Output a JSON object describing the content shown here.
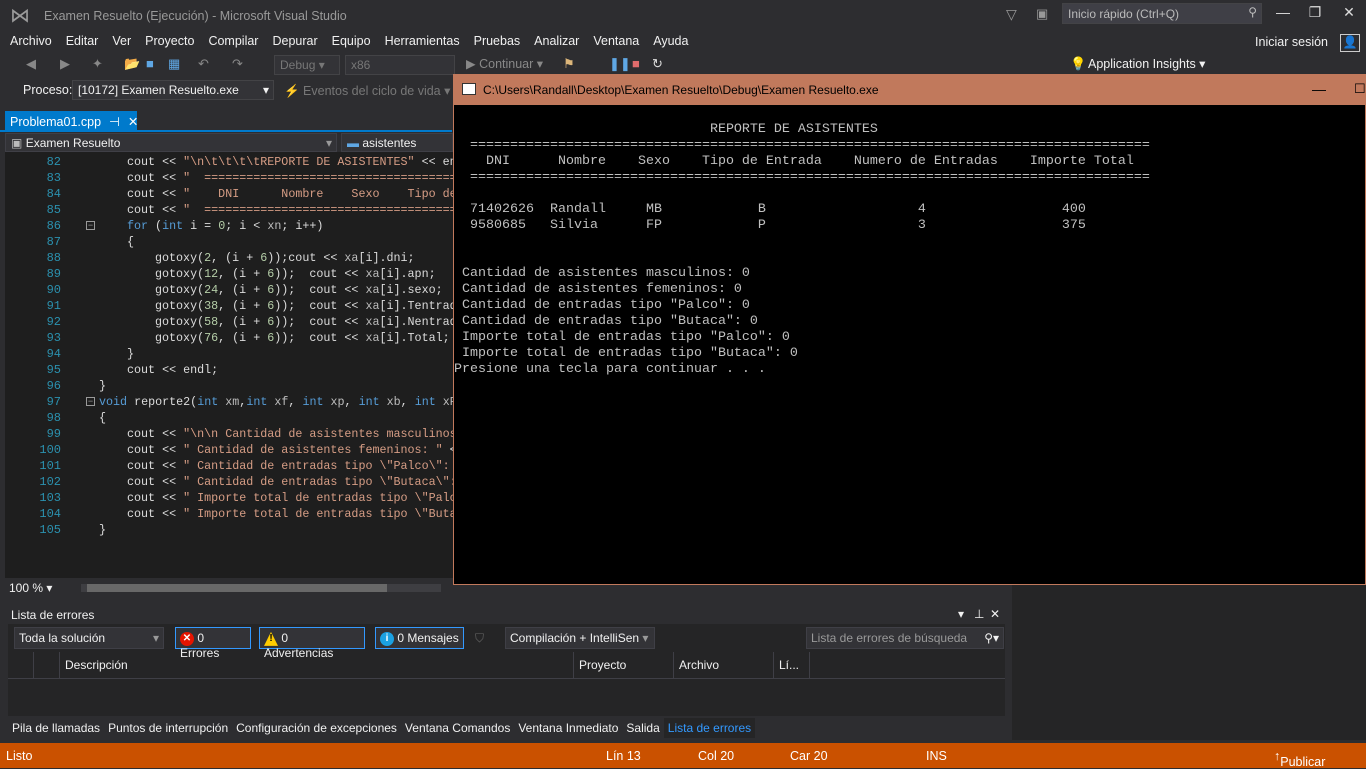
{
  "window": {
    "title": "Examen Resuelto (Ejecución) - Microsoft Visual Studio",
    "quick_launch_placeholder": "Inicio rápido (Ctrl+Q)"
  },
  "menu": [
    "Archivo",
    "Editar",
    "Ver",
    "Proyecto",
    "Compilar",
    "Depurar",
    "Equipo",
    "Herramientas",
    "Pruebas",
    "Analizar",
    "Ventana",
    "Ayuda"
  ],
  "signin": "Iniciar sesión",
  "toolbar": {
    "config": "Debug",
    "platform": "x86",
    "continue": "Continuar",
    "app_insights": "Application Insights"
  },
  "process": {
    "label": "Proceso:",
    "value": "[10172] Examen Resuelto.exe",
    "lifecycle": "Eventos del ciclo de vida"
  },
  "doc_tab": {
    "name": "Problema01.cpp"
  },
  "nav": {
    "project": "Examen Resuelto",
    "member": "asistentes"
  },
  "editor": {
    "zoom": "100 %",
    "lines": [
      {
        "n": "82",
        "indent": 4,
        "tokens": [
          [
            "p",
            "cout << "
          ],
          [
            "s",
            "\"\\n\\t\\t\\t\\tREPORTE DE ASISTENTES\""
          ],
          [
            "p",
            " << en"
          ]
        ]
      },
      {
        "n": "83",
        "indent": 4,
        "tokens": [
          [
            "p",
            "cout << "
          ],
          [
            "s",
            "\"  ======================================"
          ]
        ]
      },
      {
        "n": "84",
        "indent": 4,
        "tokens": [
          [
            "p",
            "cout << "
          ],
          [
            "s",
            "\"    DNI      Nombre    Sexo    Tipo de"
          ]
        ]
      },
      {
        "n": "85",
        "indent": 4,
        "tokens": [
          [
            "p",
            "cout << "
          ],
          [
            "s",
            "\"  ======================================"
          ]
        ]
      },
      {
        "n": "86",
        "indent": 4,
        "fold": true,
        "tokens": [
          [
            "k",
            "for"
          ],
          [
            "p",
            " ("
          ],
          [
            "k",
            "int"
          ],
          [
            "p",
            " i = "
          ],
          [
            "n",
            "0"
          ],
          [
            "p",
            "; i < "
          ],
          [
            "m",
            "xn"
          ],
          [
            "p",
            "; i++)"
          ]
        ]
      },
      {
        "n": "87",
        "indent": 4,
        "tokens": [
          [
            "p",
            "{"
          ]
        ]
      },
      {
        "n": "88",
        "indent": 8,
        "tokens": [
          [
            "p",
            "gotoxy("
          ],
          [
            "n",
            "2"
          ],
          [
            "p",
            ", (i + "
          ],
          [
            "n",
            "6"
          ],
          [
            "p",
            "));cout << "
          ],
          [
            "m",
            "xa"
          ],
          [
            "p",
            "[i].dni;"
          ]
        ]
      },
      {
        "n": "89",
        "indent": 8,
        "tokens": [
          [
            "p",
            "gotoxy("
          ],
          [
            "n",
            "12"
          ],
          [
            "p",
            ", (i + "
          ],
          [
            "n",
            "6"
          ],
          [
            "p",
            "));  cout << "
          ],
          [
            "m",
            "xa"
          ],
          [
            "p",
            "[i].apn;"
          ]
        ]
      },
      {
        "n": "90",
        "indent": 8,
        "tokens": [
          [
            "p",
            "gotoxy("
          ],
          [
            "n",
            "24"
          ],
          [
            "p",
            ", (i + "
          ],
          [
            "n",
            "6"
          ],
          [
            "p",
            "));  cout << "
          ],
          [
            "m",
            "xa"
          ],
          [
            "p",
            "[i].sexo;"
          ]
        ]
      },
      {
        "n": "91",
        "indent": 8,
        "tokens": [
          [
            "p",
            "gotoxy("
          ],
          [
            "n",
            "38"
          ],
          [
            "p",
            ", (i + "
          ],
          [
            "n",
            "6"
          ],
          [
            "p",
            "));  cout << "
          ],
          [
            "m",
            "xa"
          ],
          [
            "p",
            "[i].Tentrada"
          ]
        ]
      },
      {
        "n": "92",
        "indent": 8,
        "tokens": [
          [
            "p",
            "gotoxy("
          ],
          [
            "n",
            "58"
          ],
          [
            "p",
            ", (i + "
          ],
          [
            "n",
            "6"
          ],
          [
            "p",
            "));  cout << "
          ],
          [
            "m",
            "xa"
          ],
          [
            "p",
            "[i].Nentrada"
          ]
        ]
      },
      {
        "n": "93",
        "indent": 8,
        "tokens": [
          [
            "p",
            "gotoxy("
          ],
          [
            "n",
            "76"
          ],
          [
            "p",
            ", (i + "
          ],
          [
            "n",
            "6"
          ],
          [
            "p",
            "));  cout << "
          ],
          [
            "m",
            "xa"
          ],
          [
            "p",
            "[i].Total;"
          ]
        ]
      },
      {
        "n": "94",
        "indent": 4,
        "tokens": [
          [
            "p",
            "}"
          ]
        ]
      },
      {
        "n": "95",
        "indent": 4,
        "tokens": [
          [
            "p",
            "cout << endl;"
          ]
        ]
      },
      {
        "n": "96",
        "indent": 0,
        "tokens": [
          [
            "p",
            "}"
          ]
        ]
      },
      {
        "n": "97",
        "indent": 0,
        "fold": true,
        "tokens": [
          [
            "k",
            "void"
          ],
          [
            "p",
            " reporte2("
          ],
          [
            "k",
            "int"
          ],
          [
            "m",
            " xm"
          ],
          [
            "p",
            ","
          ],
          [
            "k",
            "int"
          ],
          [
            "m",
            " xf"
          ],
          [
            "p",
            ", "
          ],
          [
            "k",
            "int"
          ],
          [
            "m",
            " xp"
          ],
          [
            "p",
            ", "
          ],
          [
            "k",
            "int"
          ],
          [
            "m",
            " xb"
          ],
          [
            "p",
            ", "
          ],
          [
            "k",
            "int"
          ],
          [
            "m",
            " xP"
          ]
        ]
      },
      {
        "n": "98",
        "indent": 0,
        "tokens": [
          [
            "p",
            "{"
          ]
        ]
      },
      {
        "n": "99",
        "indent": 4,
        "tokens": [
          [
            "p",
            "cout << "
          ],
          [
            "s",
            "\"\\n\\n Cantidad de asistentes masculinos"
          ]
        ]
      },
      {
        "n": "100",
        "indent": 4,
        "tokens": [
          [
            "p",
            "cout << "
          ],
          [
            "s",
            "\" Cantidad de asistentes femeninos: \""
          ],
          [
            "p",
            " <"
          ]
        ]
      },
      {
        "n": "101",
        "indent": 4,
        "tokens": [
          [
            "p",
            "cout << "
          ],
          [
            "s",
            "\" Cantidad de entradas tipo \\\"Palco\\\": "
          ]
        ]
      },
      {
        "n": "102",
        "indent": 4,
        "tokens": [
          [
            "p",
            "cout << "
          ],
          [
            "s",
            "\" Cantidad de entradas tipo \\\"Butaca\\\":"
          ]
        ]
      },
      {
        "n": "103",
        "indent": 4,
        "tokens": [
          [
            "p",
            "cout << "
          ],
          [
            "s",
            "\" Importe total de entradas tipo \\\"Palc"
          ]
        ]
      },
      {
        "n": "104",
        "indent": 4,
        "tokens": [
          [
            "p",
            "cout << "
          ],
          [
            "s",
            "\" Importe total de entradas tipo \\\"Buta"
          ]
        ]
      },
      {
        "n": "105",
        "indent": 0,
        "tokens": [
          [
            "p",
            "}"
          ]
        ]
      }
    ]
  },
  "console": {
    "title": "C:\\Users\\Randall\\Desktop\\Examen Resuelto\\Debug\\Examen Resuelto.exe",
    "lines": [
      "",
      "                                REPORTE DE ASISTENTES",
      "  =====================================================================================",
      "    DNI      Nombre    Sexo    Tipo de Entrada    Numero de Entradas    Importe Total",
      "  =====================================================================================",
      "",
      "  71402626  Randall     MB            B                   4                 400",
      "  9580685   Silvia      FP            P                   3                 375",
      "",
      "",
      " Cantidad de asistentes masculinos: 0",
      " Cantidad de asistentes femeninos: 0",
      " Cantidad de entradas tipo \"Palco\": 0",
      " Cantidad de entradas tipo \"Butaca\": 0",
      " Importe total de entradas tipo \"Palco\": 0",
      " Importe total de entradas tipo \"Butaca\": 0",
      "Presione una tecla para continuar . . ."
    ]
  },
  "error_list": {
    "title": "Lista de errores",
    "scope": "Toda la solución",
    "errors": "0 Errores",
    "warnings": "0 Advertencias",
    "messages": "0 Mensajes",
    "build_filter": "Compilación + IntelliSen",
    "search_placeholder": "Lista de errores de búsqueda",
    "columns": [
      "Descripción",
      "Proyecto",
      "Archivo",
      "Lí..."
    ]
  },
  "bottom_tabs": [
    "Pila de llamadas",
    "Puntos de interrupción",
    "Configuración de excepciones",
    "Ventana Comandos",
    "Ventana Inmediato",
    "Salida",
    "Lista de errores"
  ],
  "status": {
    "state": "Listo",
    "line": "Lín 13",
    "col": "Col 20",
    "char": "Car 20",
    "mode": "INS",
    "publish": "Publicar"
  },
  "colors": {
    "accent": "#007acc",
    "status_bar": "#ca5100",
    "console_title": "#c1795c"
  }
}
